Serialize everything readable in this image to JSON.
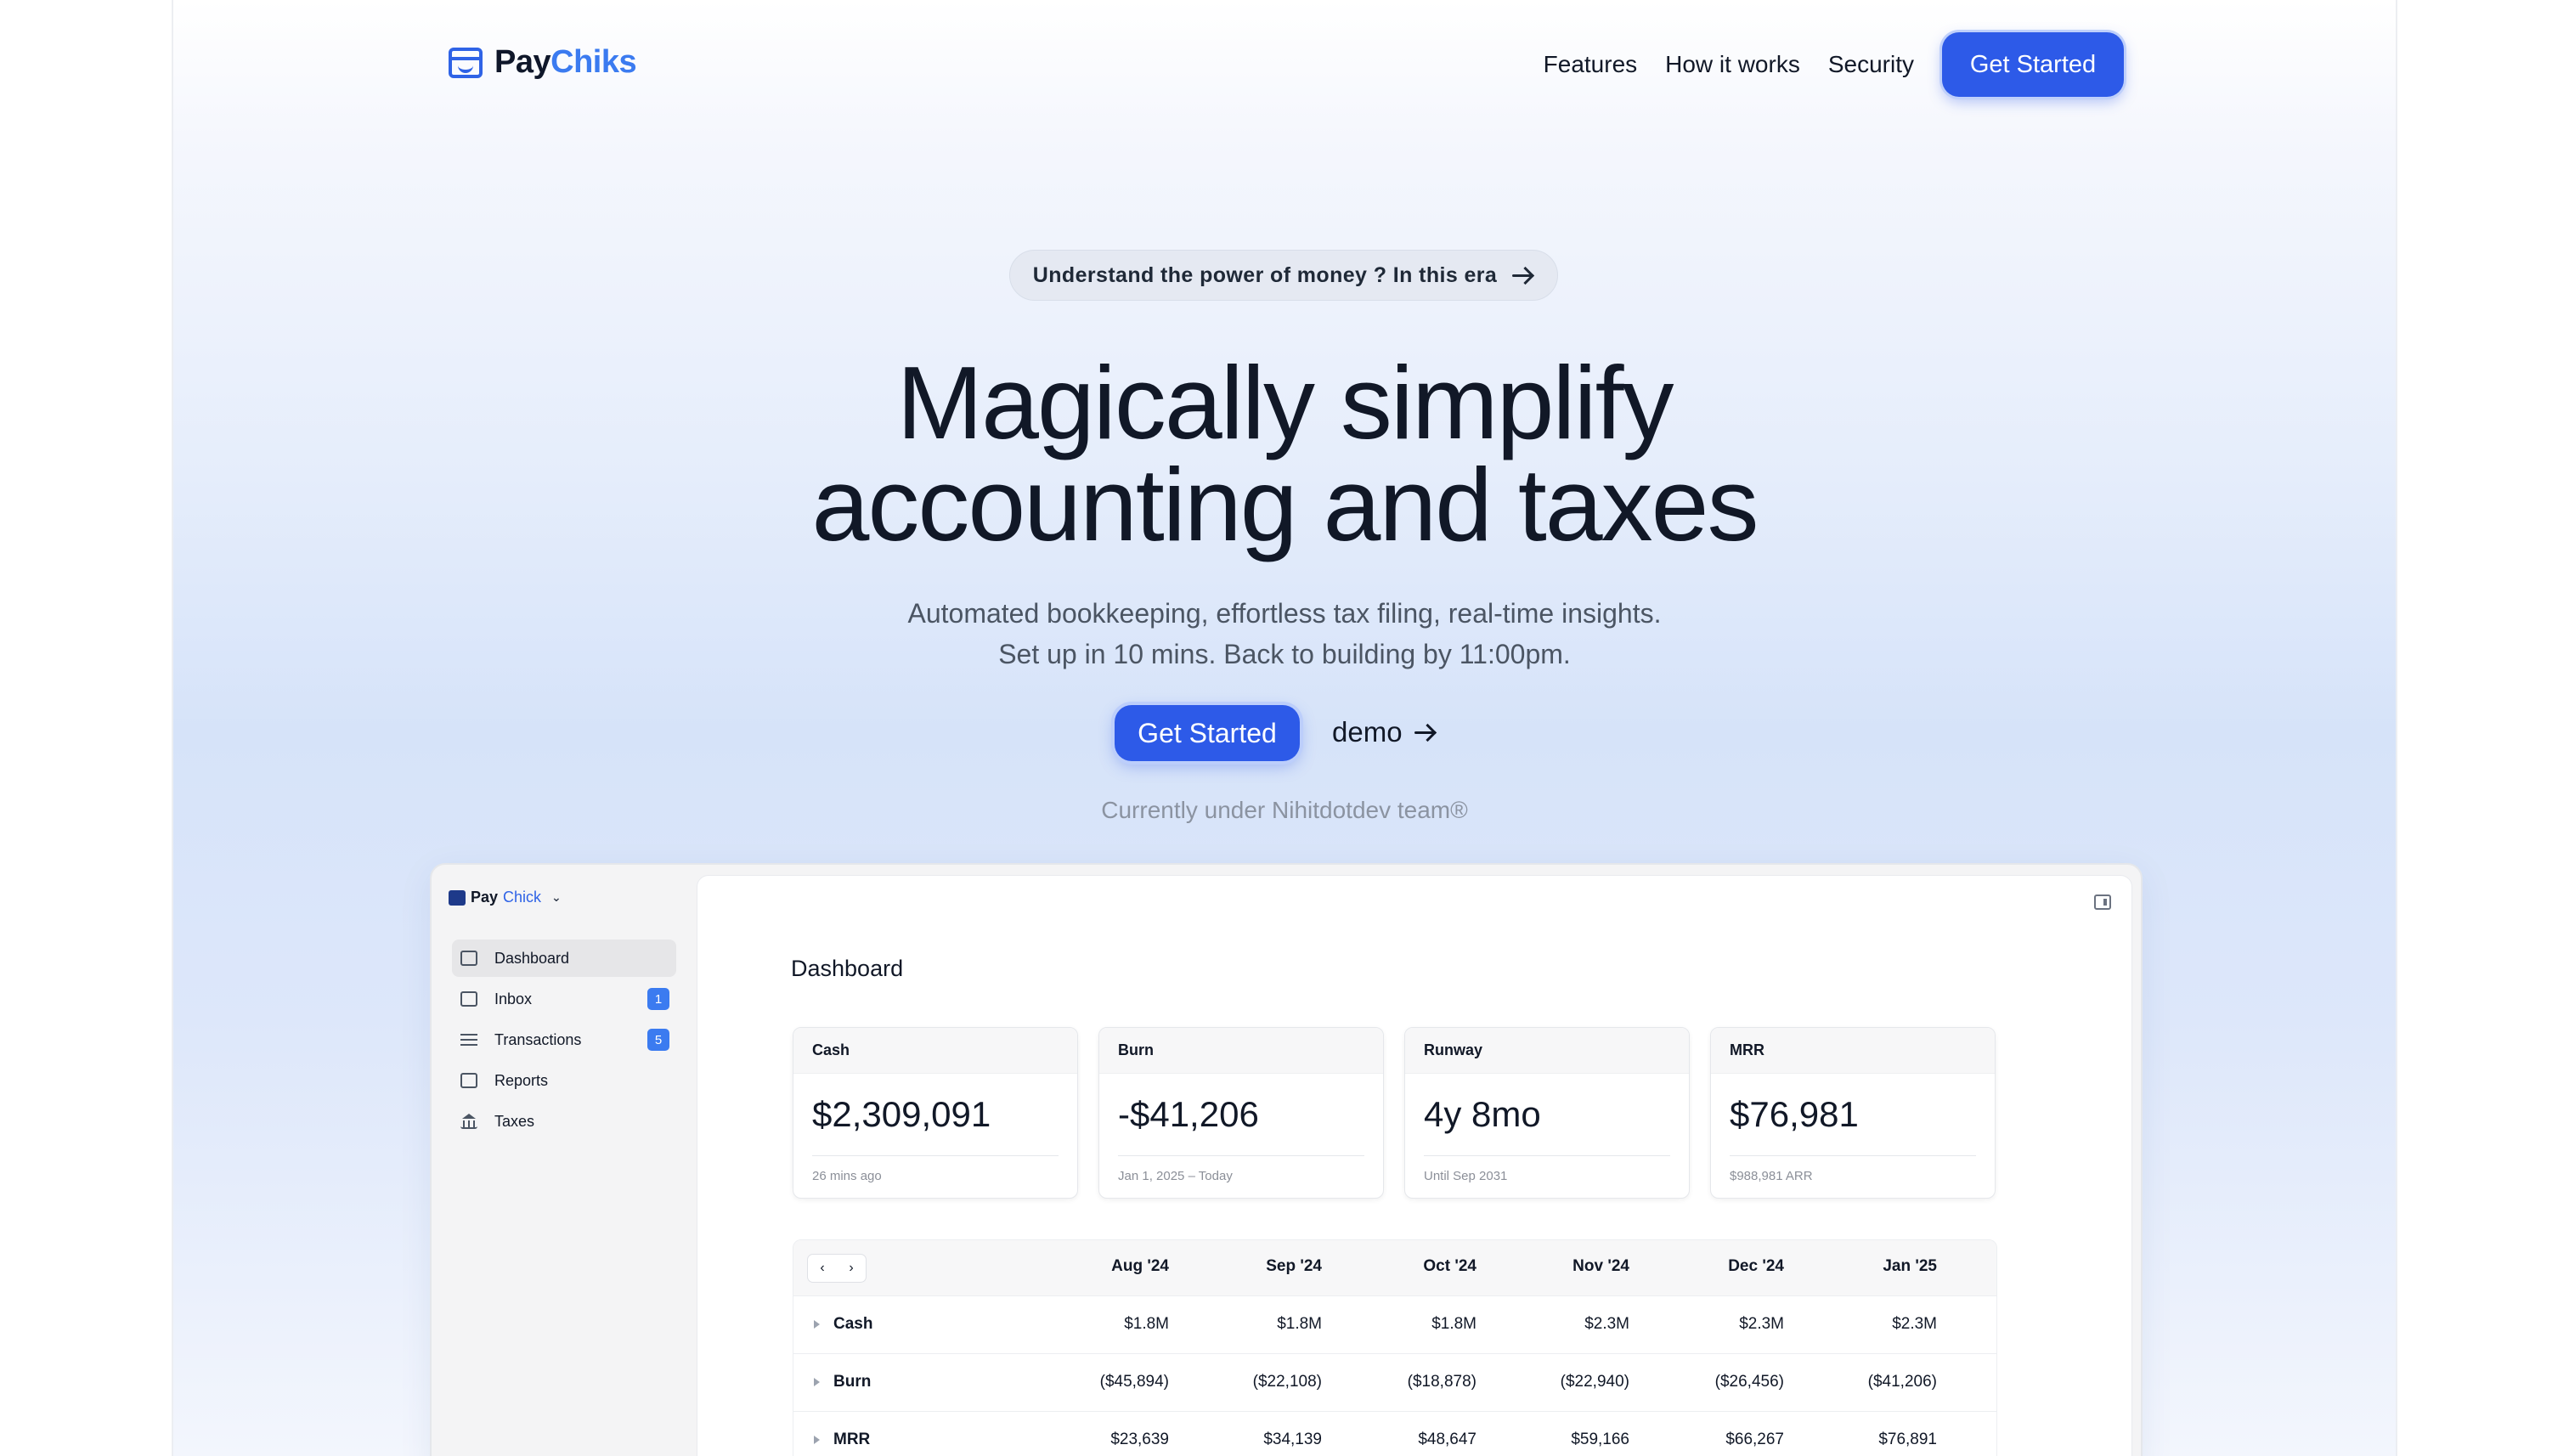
{
  "brand": {
    "name_part1": "Pay",
    "name_part2": "Chiks"
  },
  "nav": {
    "links": [
      "Features",
      "How it works",
      "Security"
    ],
    "cta": "Get Started"
  },
  "hero": {
    "pill_text": "Understand the power of money ? In this era",
    "headline_line1": "Magically simplify",
    "headline_line2": "accounting and taxes",
    "subtitle_line1": "Automated bookkeeping, effortless tax filing, real-time insights.",
    "subtitle_line2": "Set up in 10 mins. Back to building by 11:00pm.",
    "cta": "Get Started",
    "demo": "demo",
    "credit": "Currently under Nihitdotdev team®"
  },
  "app": {
    "workspace": {
      "part1": "Pay",
      "part2": "Chick"
    },
    "sidebar": [
      {
        "label": "Dashboard",
        "icon": "dashboard-icon",
        "badge": ""
      },
      {
        "label": "Inbox",
        "icon": "inbox-icon",
        "badge": "1"
      },
      {
        "label": "Transactions",
        "icon": "list-icon",
        "badge": "5"
      },
      {
        "label": "Reports",
        "icon": "report-icon",
        "badge": ""
      },
      {
        "label": "Taxes",
        "icon": "bank-icon",
        "badge": ""
      }
    ],
    "title": "Dashboard",
    "cards": [
      {
        "label": "Cash",
        "value": "$2,309,091",
        "sub": "26 mins ago"
      },
      {
        "label": "Burn",
        "value": "-$41,206",
        "sub": "Jan 1, 2025 – Today"
      },
      {
        "label": "Runway",
        "value": "4y 8mo",
        "sub": "Until Sep 2031"
      },
      {
        "label": "MRR",
        "value": "$76,981",
        "sub": "$988,981 ARR"
      }
    ],
    "table": {
      "columns": [
        "Aug '24",
        "Sep '24",
        "Oct '24",
        "Nov '24",
        "Dec '24",
        "Jan '25"
      ],
      "rows": [
        {
          "label": "Cash",
          "values": [
            "$1.8M",
            "$1.8M",
            "$1.8M",
            "$2.3M",
            "$2.3M",
            "$2.3M"
          ]
        },
        {
          "label": "Burn",
          "values": [
            "($45,894)",
            "($22,108)",
            "($18,878)",
            "($22,940)",
            "($26,456)",
            "($41,206)"
          ]
        },
        {
          "label": "MRR",
          "values": [
            "$23,639",
            "$34,139",
            "$48,647",
            "$59,166",
            "$66,267",
            "$76,891"
          ]
        }
      ]
    }
  },
  "colors": {
    "accent": "#2d5ae8",
    "brand_secondary": "#3b7bf0",
    "text": "#111827"
  }
}
